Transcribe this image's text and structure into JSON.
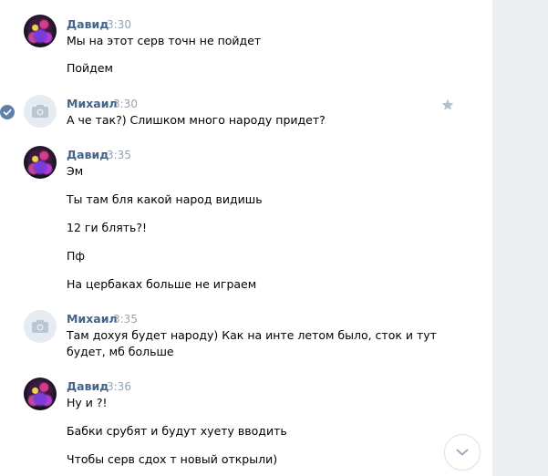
{
  "messages": [
    {
      "author": "Давид",
      "time": "3:30",
      "lines": [
        "Мы на этот серв точн не пойдет",
        "Пойдем"
      ]
    },
    {
      "author": "Михаил",
      "time": "3:30",
      "lines": [
        "А че так?) Слишком много народу придет?"
      ]
    },
    {
      "author": "Давид",
      "time": "3:35",
      "lines": [
        "Эм",
        "Ты там бля какой народ видишь",
        "12 ги блять?!",
        "Пф",
        "На цербаках больше не играем"
      ]
    },
    {
      "author": "Михаил",
      "time": "3:35",
      "lines": [
        "Там дохуя будет народу) Как на инте летом было, сток и тут",
        "будет, мб больше"
      ]
    },
    {
      "author": "Давид",
      "time": "3:36",
      "lines": [
        "Ну и ?!",
        "Бабки срубят и будут хуету вводить",
        "Чтобы серв сдох т новый открыли)"
      ]
    }
  ],
  "icons": {
    "selected": "check-circle-icon",
    "favorite": "star-icon",
    "scroll": "chevron-down-icon",
    "avatar_placeholder": "camera-icon"
  },
  "colors": {
    "author": "#42648b",
    "time": "#93a3b5",
    "gutter": "#edeef0"
  }
}
